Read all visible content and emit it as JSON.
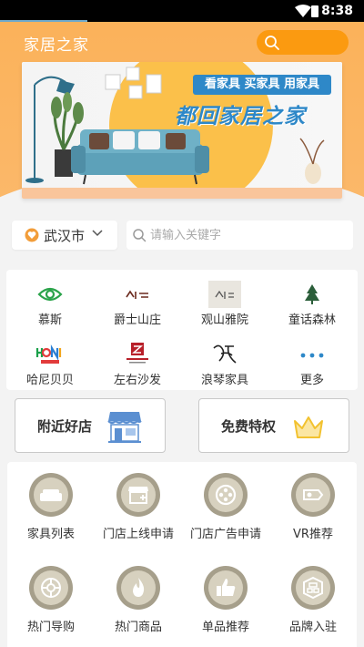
{
  "status_bar": {
    "time": "8:38"
  },
  "header": {
    "title": "家居之家"
  },
  "banner": {
    "tag": "看家具  买家具  用家具",
    "slogan": "都回家居之家"
  },
  "location": {
    "city": "武汉市"
  },
  "search": {
    "placeholder": "请输入关键字"
  },
  "brands": [
    {
      "name": "慕斯",
      "icon": "eye-icon"
    },
    {
      "name": "爵士山庄",
      "icon": "jueshi-logo"
    },
    {
      "name": "观山雅院",
      "icon": "guanshan-logo"
    },
    {
      "name": "童话森林",
      "icon": "tonghua-logo"
    },
    {
      "name": "哈尼贝贝",
      "icon": "honey-logo"
    },
    {
      "name": "左右沙发",
      "icon": "zuoyou-logo"
    },
    {
      "name": "浪琴家具",
      "icon": "langqin-logo"
    },
    {
      "name": "更多",
      "icon": "more-dots-icon"
    }
  ],
  "cards": [
    {
      "label": "附近好店",
      "icon": "store-icon"
    },
    {
      "label": "免费特权",
      "icon": "crown-icon"
    }
  ],
  "services": [
    {
      "label": "家具列表",
      "icon": "sofa-icon"
    },
    {
      "label": "门店上线申请",
      "icon": "store-add-icon"
    },
    {
      "label": "门店广告申请",
      "icon": "film-reel-icon"
    },
    {
      "label": "VR推荐",
      "icon": "vr-headset-icon"
    },
    {
      "label": "热门导购",
      "icon": "guide-icon"
    },
    {
      "label": "热门商品",
      "icon": "flame-icon"
    },
    {
      "label": "单品推荐",
      "icon": "thumbs-up-icon"
    },
    {
      "label": "品牌入驻",
      "icon": "brand-badge-icon"
    }
  ],
  "colors": {
    "accent": "#fb9a10",
    "header_bg": "#fbb25a",
    "brand_blue": "#2e88c8",
    "icon_gold": "#a69f8b",
    "crown": "#f2c230"
  }
}
